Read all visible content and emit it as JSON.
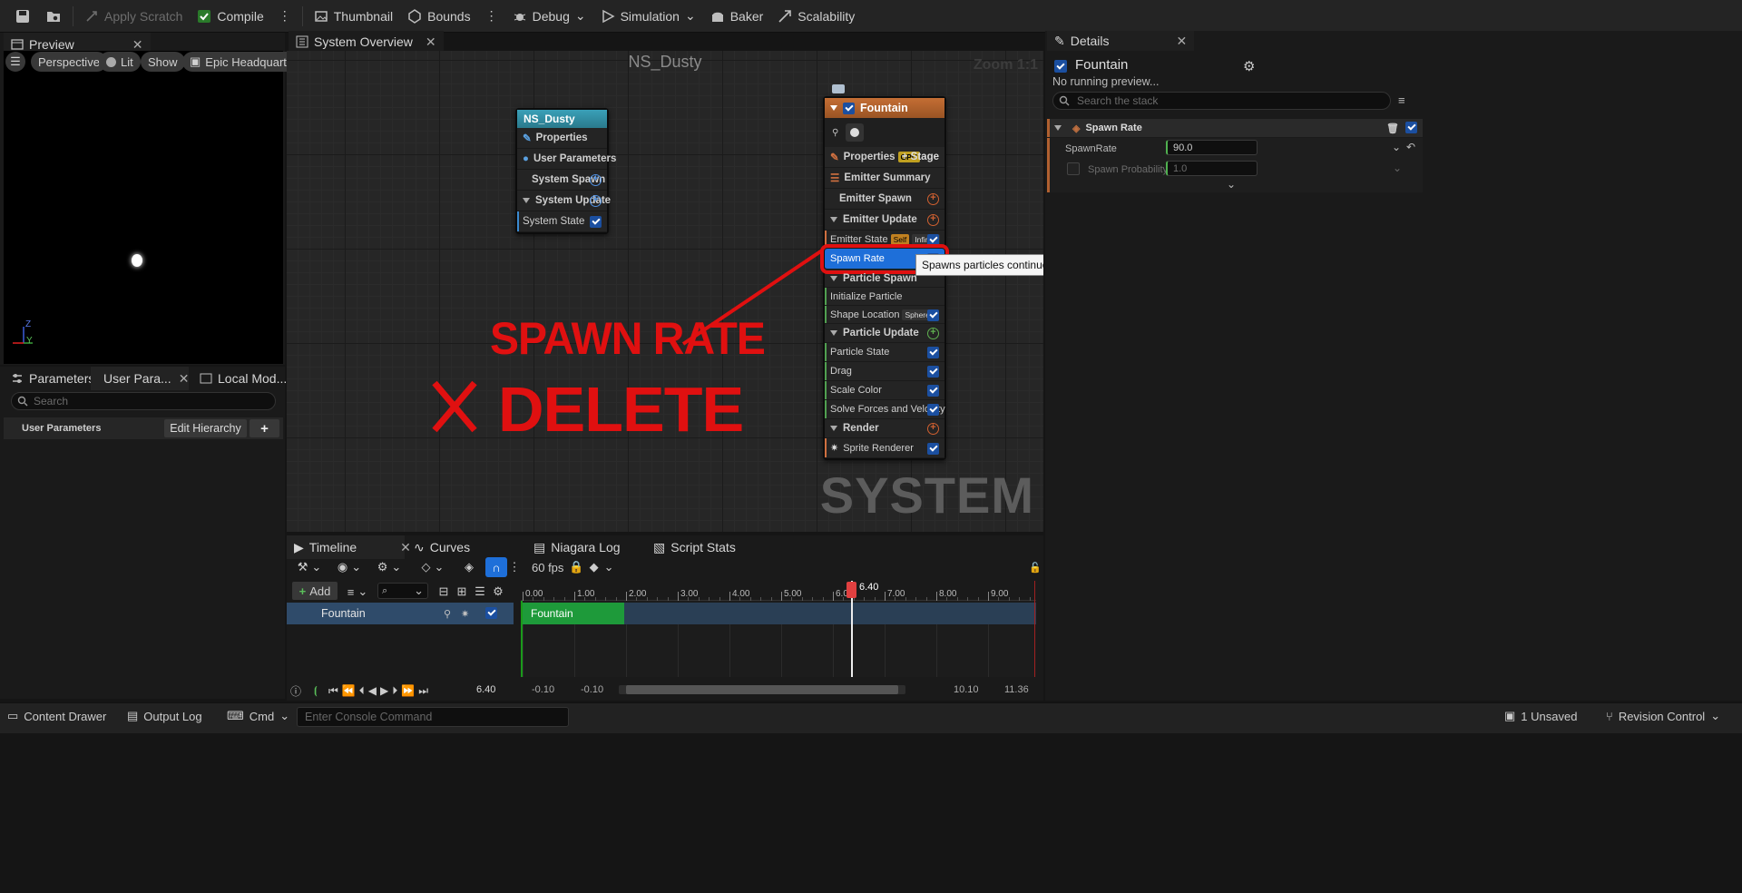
{
  "toolbar": {
    "apply_scratch": "Apply Scratch",
    "compile": "Compile",
    "thumbnail": "Thumbnail",
    "bounds": "Bounds",
    "debug": "Debug",
    "simulation": "Simulation",
    "baker": "Baker",
    "scalability": "Scalability"
  },
  "preview": {
    "tab": "Preview",
    "perspective": "Perspective",
    "lit": "Lit",
    "show": "Show",
    "environment": "Epic Headquarters",
    "axis_z": "Z",
    "axis_y": "Y"
  },
  "params": {
    "tabs": [
      "Parameters",
      "User Para...",
      "Local Mod..."
    ],
    "search_placeholder": "Search",
    "section": "User Parameters",
    "edit_hierarchy": "Edit Hierarchy",
    "add": "+"
  },
  "graph": {
    "tab": "System Overview",
    "title": "NS_Dusty",
    "zoom": "Zoom 1:1",
    "watermark": "SYSTEM"
  },
  "system_node": {
    "title": "NS_Dusty",
    "rows": [
      "Properties",
      "User Parameters",
      "System Spawn",
      "System Update",
      "System State"
    ]
  },
  "emitter_node": {
    "title": "Fountain",
    "properties": "Properties",
    "gpu_badge": "GPU",
    "stage": "+ Stage",
    "emitter_summary": "Emitter Summary",
    "emitter_spawn": "Emitter Spawn",
    "emitter_update": "Emitter Update",
    "emitter_state": "Emitter State",
    "self_badge": "Self",
    "infinite_badge": "Infinite",
    "spawn_rate": "Spawn Rate",
    "particle_spawn": "Particle Spawn",
    "initialize_particle": "Initialize Particle",
    "shape_location": "Shape Location",
    "sphere_badge": "Sphere",
    "particle_update": "Particle Update",
    "particle_state": "Particle State",
    "drag": "Drag",
    "scale_color": "Scale Color",
    "solve_forces": "Solve Forces and Velocity",
    "render": "Render",
    "sprite_renderer": "Sprite Renderer"
  },
  "tooltip": "Spawns particles continuously at a particular rate.",
  "annotations": {
    "spawn_rate": "SPAWN RATE",
    "delete": "DELETE"
  },
  "details": {
    "tab": "Details",
    "emitter": "Fountain",
    "status": "No running preview...",
    "search_placeholder": "Search the stack",
    "section": "Spawn Rate",
    "spawn_rate_label": "SpawnRate",
    "spawn_rate_value": "90.0",
    "spawn_prob_label": "Spawn Probability",
    "spawn_prob_value": "1.0"
  },
  "timeline": {
    "tabs": [
      "Timeline",
      "Curves",
      "Niagara Log",
      "Script Stats"
    ],
    "fps": "60 fps",
    "add": "Add",
    "track": "Fountain",
    "clip": "Fountain",
    "playhead": "6.40",
    "current_time": "6.40",
    "ticks": [
      "0.00",
      "1.00",
      "2.00",
      "3.00",
      "4.00",
      "5.00",
      "6.00",
      "7.00",
      "8.00",
      "9.00"
    ],
    "range_start_a": "-0.10",
    "range_start_b": "-0.10",
    "range_end_a": "10.10",
    "range_end_b": "11.36"
  },
  "statusbar": {
    "content_drawer": "Content Drawer",
    "output_log": "Output Log",
    "cmd": "Cmd",
    "console_placeholder": "Enter Console Command",
    "unsaved": "1 Unsaved",
    "revision": "Revision Control"
  },
  "colors": {
    "accent": "#1e6fd9",
    "annotation": "#e01010",
    "emitter_header": "#b8622a",
    "system_header": "#2e8aa0",
    "clip": "#1e9a3a"
  }
}
